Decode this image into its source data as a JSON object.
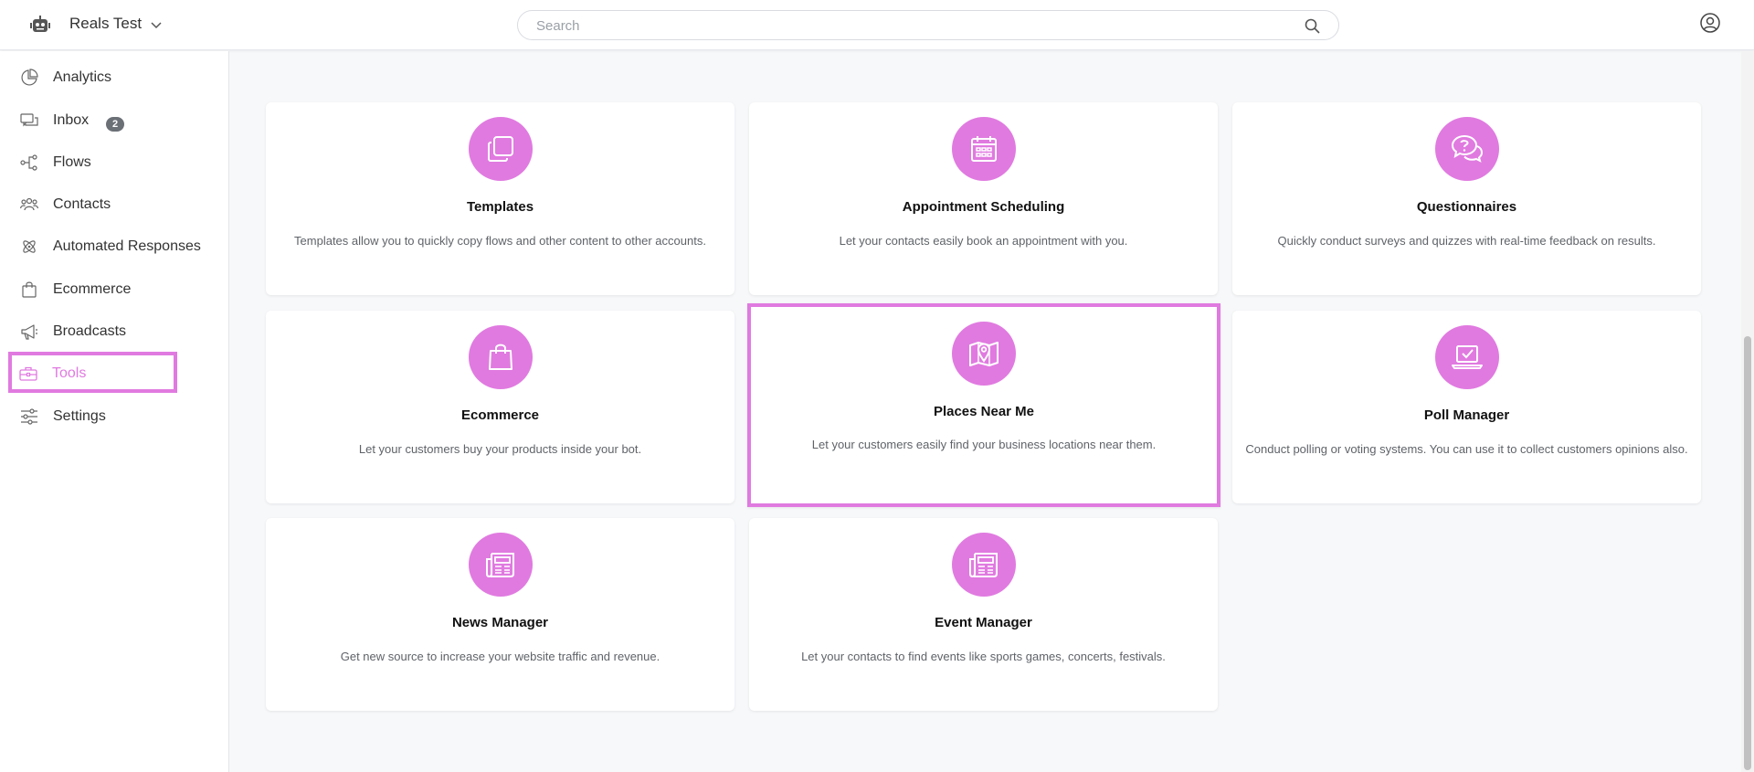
{
  "header": {
    "account_name": "Reals Test",
    "search_placeholder": "Search"
  },
  "sidebar": {
    "items": [
      {
        "label": "Analytics",
        "icon": "analytics-icon"
      },
      {
        "label": "Inbox",
        "icon": "inbox-icon",
        "badge": "2"
      },
      {
        "label": "Flows",
        "icon": "flows-icon"
      },
      {
        "label": "Contacts",
        "icon": "contacts-icon"
      },
      {
        "label": "Automated Responses",
        "icon": "automated-responses-icon"
      },
      {
        "label": "Ecommerce",
        "icon": "shopping-bag-icon"
      },
      {
        "label": "Broadcasts",
        "icon": "megaphone-icon"
      },
      {
        "label": "Tools",
        "icon": "toolbox-icon",
        "active": true
      },
      {
        "label": "Settings",
        "icon": "sliders-icon"
      }
    ]
  },
  "tools": [
    {
      "title": "Templates",
      "description": "Templates allow you to quickly copy flows and other content to other accounts.",
      "icon": "copy-icon"
    },
    {
      "title": "Appointment Scheduling",
      "description": "Let your contacts easily book an appointment with you.",
      "icon": "calendar-icon"
    },
    {
      "title": "Questionnaires",
      "description": "Quickly conduct surveys and quizzes with real-time feedback on results.",
      "icon": "question-chat-icon"
    },
    {
      "title": "Ecommerce",
      "description": "Let your customers buy your products inside your bot.",
      "icon": "shopping-bag-icon"
    },
    {
      "title": "Places Near Me",
      "description": "Let your customers easily find your business locations near them.",
      "icon": "map-pin-icon",
      "highlighted": true
    },
    {
      "title": "Poll Manager",
      "description": "Conduct polling or voting systems. You can use it to collect customers opinions also.",
      "icon": "laptop-check-icon"
    },
    {
      "title": "News Manager",
      "description": "Get new source to increase your website traffic and revenue.",
      "icon": "newspaper-icon"
    },
    {
      "title": "Event Manager",
      "description": "Let your contacts to find events like sports games, concerts, festivals.",
      "icon": "newspaper-icon"
    }
  ],
  "colors": {
    "accent": "#e07ae0",
    "badge": "#6b6f76"
  }
}
